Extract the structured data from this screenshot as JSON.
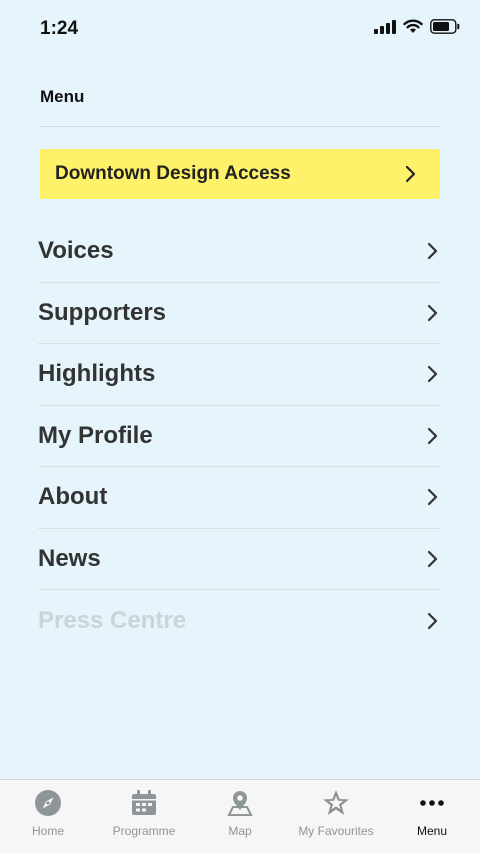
{
  "status_bar": {
    "time": "1:24"
  },
  "header": {
    "title": "Menu"
  },
  "banner": {
    "label": "Downtown Design Access"
  },
  "menu": {
    "items": [
      {
        "label": "Voices"
      },
      {
        "label": "Supporters"
      },
      {
        "label": "Highlights"
      },
      {
        "label": "My Profile"
      },
      {
        "label": "About"
      },
      {
        "label": "News"
      },
      {
        "label": "Press Centre"
      }
    ]
  },
  "tab_bar": {
    "tabs": [
      {
        "label": "Home",
        "icon": "compass-icon"
      },
      {
        "label": "Programme",
        "icon": "calendar-icon"
      },
      {
        "label": "Map",
        "icon": "map-pin-icon"
      },
      {
        "label": "My Favourites",
        "icon": "star-icon"
      },
      {
        "label": "Menu",
        "icon": "more-dots-icon"
      }
    ],
    "active": "Menu"
  },
  "colors": {
    "background": "#e6f4fc",
    "banner": "#fdf26a",
    "text": "#333333",
    "disabled_text": "#c9d5da",
    "tab_inactive": "#8e9599"
  }
}
